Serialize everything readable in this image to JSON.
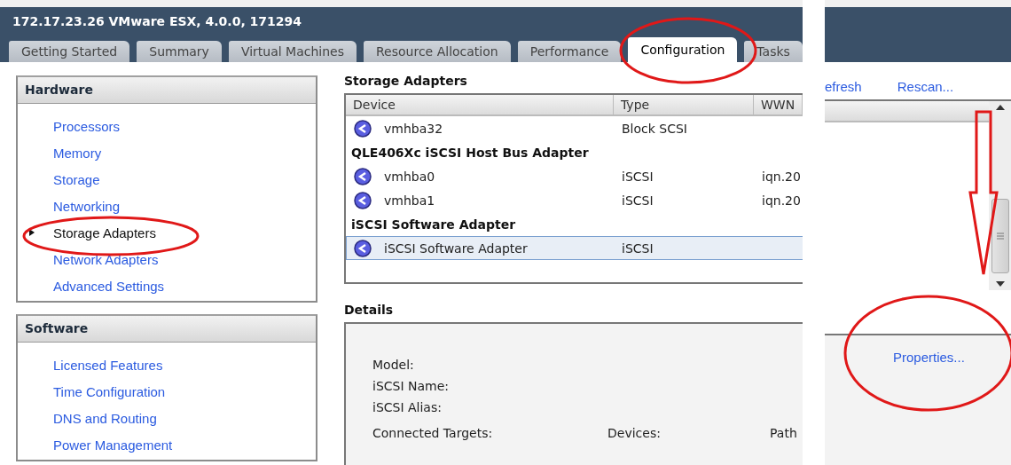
{
  "window": {
    "title": "172.17.23.26 VMware ESX, 4.0.0, 171294"
  },
  "tabs": [
    {
      "label": "Getting Started",
      "selected": false
    },
    {
      "label": "Summary",
      "selected": false
    },
    {
      "label": "Virtual Machines",
      "selected": false
    },
    {
      "label": "Resource Allocation",
      "selected": false
    },
    {
      "label": "Performance",
      "selected": false
    },
    {
      "label": "Configuration",
      "selected": true
    },
    {
      "label": "Tasks",
      "selected": false
    }
  ],
  "sidebar": {
    "sections": [
      {
        "title": "Hardware",
        "items": [
          {
            "label": "Processors",
            "selected": false
          },
          {
            "label": "Memory",
            "selected": false
          },
          {
            "label": "Storage",
            "selected": false
          },
          {
            "label": "Networking",
            "selected": false
          },
          {
            "label": "Storage Adapters",
            "selected": true
          },
          {
            "label": "Network Adapters",
            "selected": false
          },
          {
            "label": "Advanced Settings",
            "selected": false
          }
        ]
      },
      {
        "title": "Software",
        "items": [
          {
            "label": "Licensed Features",
            "selected": false
          },
          {
            "label": "Time Configuration",
            "selected": false
          },
          {
            "label": "DNS and Routing",
            "selected": false
          },
          {
            "label": "Power Management",
            "selected": false
          }
        ]
      }
    ]
  },
  "storage_adapters": {
    "title": "Storage Adapters",
    "columns": [
      "Device",
      "Type",
      "WWN"
    ],
    "rows": [
      {
        "kind": "device",
        "device": "vmhba32",
        "type": "Block SCSI",
        "selected": false
      },
      {
        "kind": "group",
        "label": "QLE406Xc iSCSI Host Bus Adapter"
      },
      {
        "kind": "device",
        "device": "vmhba0",
        "type": "iSCSI",
        "wwn": "iqn.20",
        "selected": false
      },
      {
        "kind": "device",
        "device": "vmhba1",
        "type": "iSCSI",
        "wwn": "iqn.20",
        "selected": false
      },
      {
        "kind": "group",
        "label": "iSCSI Software Adapter"
      },
      {
        "kind": "device",
        "device": "iSCSI Software Adapter",
        "type": "iSCSI",
        "selected": true
      }
    ]
  },
  "details": {
    "title": "Details",
    "fields": [
      "Model:",
      "iSCSI Name:",
      "iSCSI Alias:"
    ],
    "counts": [
      "Connected Targets:",
      "Devices:",
      "Path"
    ]
  },
  "right_panel": {
    "links": [
      "efresh",
      "Rescan..."
    ],
    "properties_link": "Properties..."
  }
}
